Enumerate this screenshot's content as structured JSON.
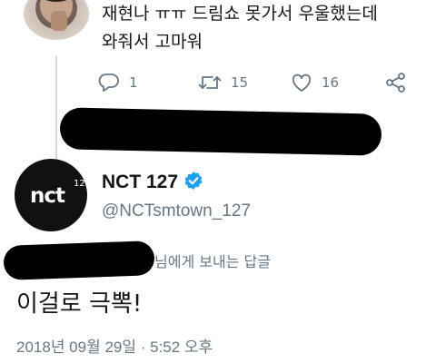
{
  "parent_tweet": {
    "text_line1": "재현나 ㅠㅠ 드림쇼 못가서 우울했는데",
    "text_line2": "와줘서 고마워",
    "actions": {
      "reply_count": "1",
      "retweet_count": "15",
      "like_count": "16"
    }
  },
  "tweet": {
    "display_name": "NCT 127",
    "handle": "@NCTsmtown_127",
    "avatar": {
      "logo_text": "nct",
      "logo_superscript": "127"
    },
    "reply_to_suffix": "님에게 보내는 답글",
    "text": "이걸로 극뽁!",
    "timestamp": "2018년 09월 29일 · 5:52 오후"
  },
  "icons": {
    "reply": "reply-icon",
    "retweet": "retweet-icon",
    "like": "heart-icon",
    "share": "share-icon",
    "verified": "verified-badge-icon"
  },
  "colors": {
    "text_primary": "#14171a",
    "text_secondary": "#657786",
    "verified_blue": "#1da1f2",
    "thread_line": "#cfd9de",
    "redaction": "#000000"
  }
}
